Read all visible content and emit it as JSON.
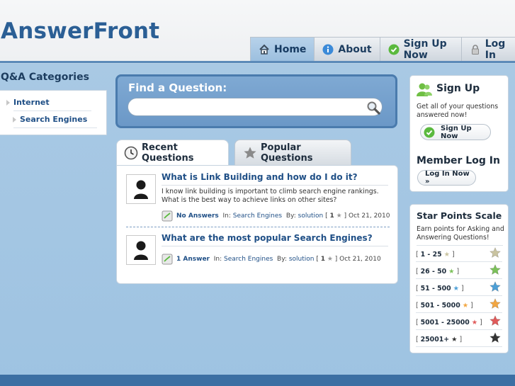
{
  "site": {
    "title": "AnswerFront"
  },
  "nav": [
    {
      "label": "Home",
      "icon": "home-icon",
      "active": true
    },
    {
      "label": "About",
      "icon": "info-icon",
      "active": false
    },
    {
      "label": "Sign Up Now",
      "icon": "check-icon",
      "active": false
    },
    {
      "label": "Log In",
      "icon": "lock-icon",
      "active": false
    }
  ],
  "categories": {
    "title": "Q&A Categories",
    "items": [
      {
        "label": "Internet"
      },
      {
        "label": "Search Engines"
      }
    ]
  },
  "search": {
    "title": "Find a Question:",
    "placeholder": "",
    "value": ""
  },
  "tabs": [
    {
      "label": "Recent Questions",
      "icon": "clock-icon",
      "active": true
    },
    {
      "label": "Popular Questions",
      "icon": "star-icon",
      "active": false
    }
  ],
  "questions": [
    {
      "title": "What is Link Building and how do I do it?",
      "excerpt": "I know link building is important to climb search engine rankings. What is the best way to achieve links on other sites?",
      "answers": "No Answers",
      "in_label": "In:",
      "category": "Search Engines",
      "by_label": "By:",
      "author": "solution",
      "points": "1",
      "date": "Oct 21, 2010"
    },
    {
      "title": "What are the most popular Search Engines?",
      "excerpt": "",
      "answers": "1 Answer",
      "in_label": "In:",
      "category": "Search Engines",
      "by_label": "By:",
      "author": "solution",
      "points": "1",
      "date": "Oct 21, 2010"
    }
  ],
  "signup": {
    "title": "Sign Up",
    "text": "Get all of your questions answered now!",
    "button": "Sign Up Now"
  },
  "login": {
    "title": "Member Log In",
    "button": "Log In Now »"
  },
  "star_scale": {
    "title": "Star Points Scale",
    "text": "Earn points for Asking and Answering Questions!",
    "levels": [
      {
        "range": "1 - 25",
        "color": "#c9c3a0"
      },
      {
        "range": "26 - 50",
        "color": "#7cc15a"
      },
      {
        "range": "51 - 500",
        "color": "#4d9fd6"
      },
      {
        "range": "501 - 5000",
        "color": "#f2a641"
      },
      {
        "range": "5001 - 25000",
        "color": "#e05a5a"
      },
      {
        "range": "25001+",
        "color": "#333333"
      }
    ]
  },
  "colors": {
    "brand": "#2b5f95",
    "link": "#1f4f86",
    "accent": "#4a7bad",
    "background": "#9ec3e2"
  }
}
